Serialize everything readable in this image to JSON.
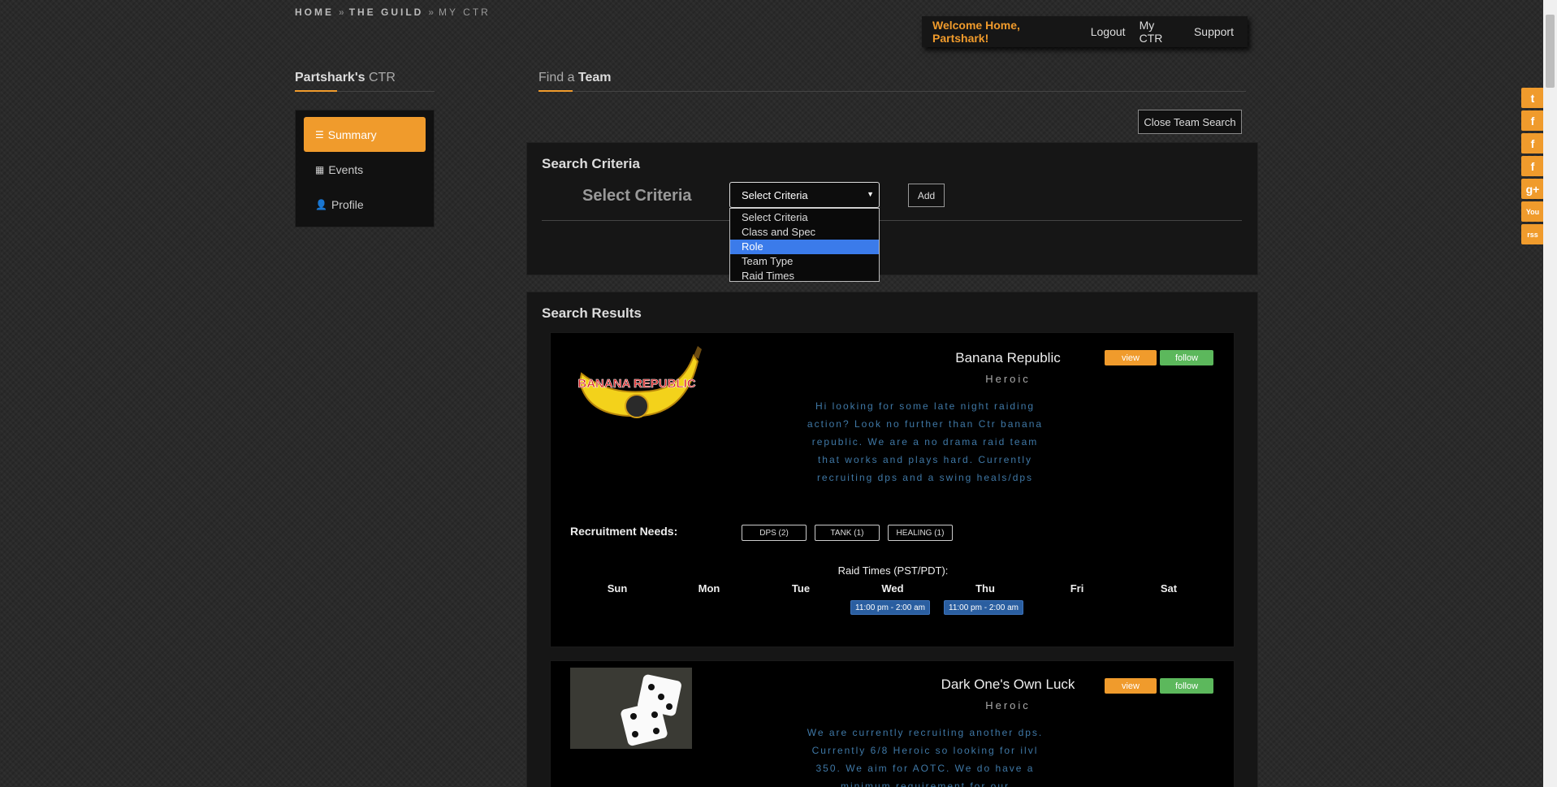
{
  "breadcrumb": {
    "home": "HOME",
    "sep": "»",
    "guild": "THE GUILD",
    "current": "MY CTR"
  },
  "user_nav": {
    "welcome": "Welcome Home, Partshark!",
    "logout": "Logout",
    "my_ctr": "My CTR",
    "support": "Support"
  },
  "left": {
    "title_bold": "Partshark's",
    "title_rest": "CTR",
    "items": [
      {
        "label": "Summary",
        "icon": "table-icon"
      },
      {
        "label": "Events",
        "icon": "calendar-icon"
      },
      {
        "label": "Profile",
        "icon": "user-icon"
      }
    ]
  },
  "find": {
    "title_pre": "Find a",
    "title_bold": "Team",
    "close_button": "Close Team Search"
  },
  "criteria": {
    "panel_title": "Search Criteria",
    "label": "Select Criteria",
    "selected": "Select Criteria",
    "add_button": "Add",
    "options": [
      "Select Criteria",
      "Class and Spec",
      "Role",
      "Team Type",
      "Raid Times"
    ],
    "highlighted_option": "Role"
  },
  "results": {
    "panel_title": "Search Results",
    "recruitment_label": "Recruitment Needs:",
    "raid_times_label": "Raid Times (PST/PDT):",
    "days": [
      "Sun",
      "Mon",
      "Tue",
      "Wed",
      "Thu",
      "Fri",
      "Sat"
    ],
    "view_label": "view",
    "follow_label": "follow",
    "teams": [
      {
        "name": "Banana Republic",
        "level": "Heroic",
        "description": "Hi looking for some late night raiding action? Look no further than Ctr banana republic. We are a no drama raid team that works and plays hard. Currently recruiting dps and a swing heals/dps",
        "logo_text": "BANANA REPUBLIC",
        "needs": [
          "DPS (2)",
          "TANK (1)",
          "HEALING (1)"
        ],
        "raid_times": {
          "Wed": "11:00 pm - 2:00 am",
          "Thu": "11:00 pm - 2:00 am"
        }
      },
      {
        "name": "Dark One's Own Luck",
        "level": "Heroic",
        "description": "We are currently recruiting another dps. Currently 6/8 Heroic so looking for ilvl 350. We aim for AOTC. We do have a minimum requirement for our"
      }
    ]
  },
  "social": [
    "t",
    "f",
    "f",
    "f",
    "g+",
    "You",
    "rss"
  ],
  "colors": {
    "accent": "#f09b2c",
    "follow": "#5cb85c",
    "slot": "#2a5ea0",
    "desc": "#3f78a6",
    "highlight": "#3b7bea"
  }
}
